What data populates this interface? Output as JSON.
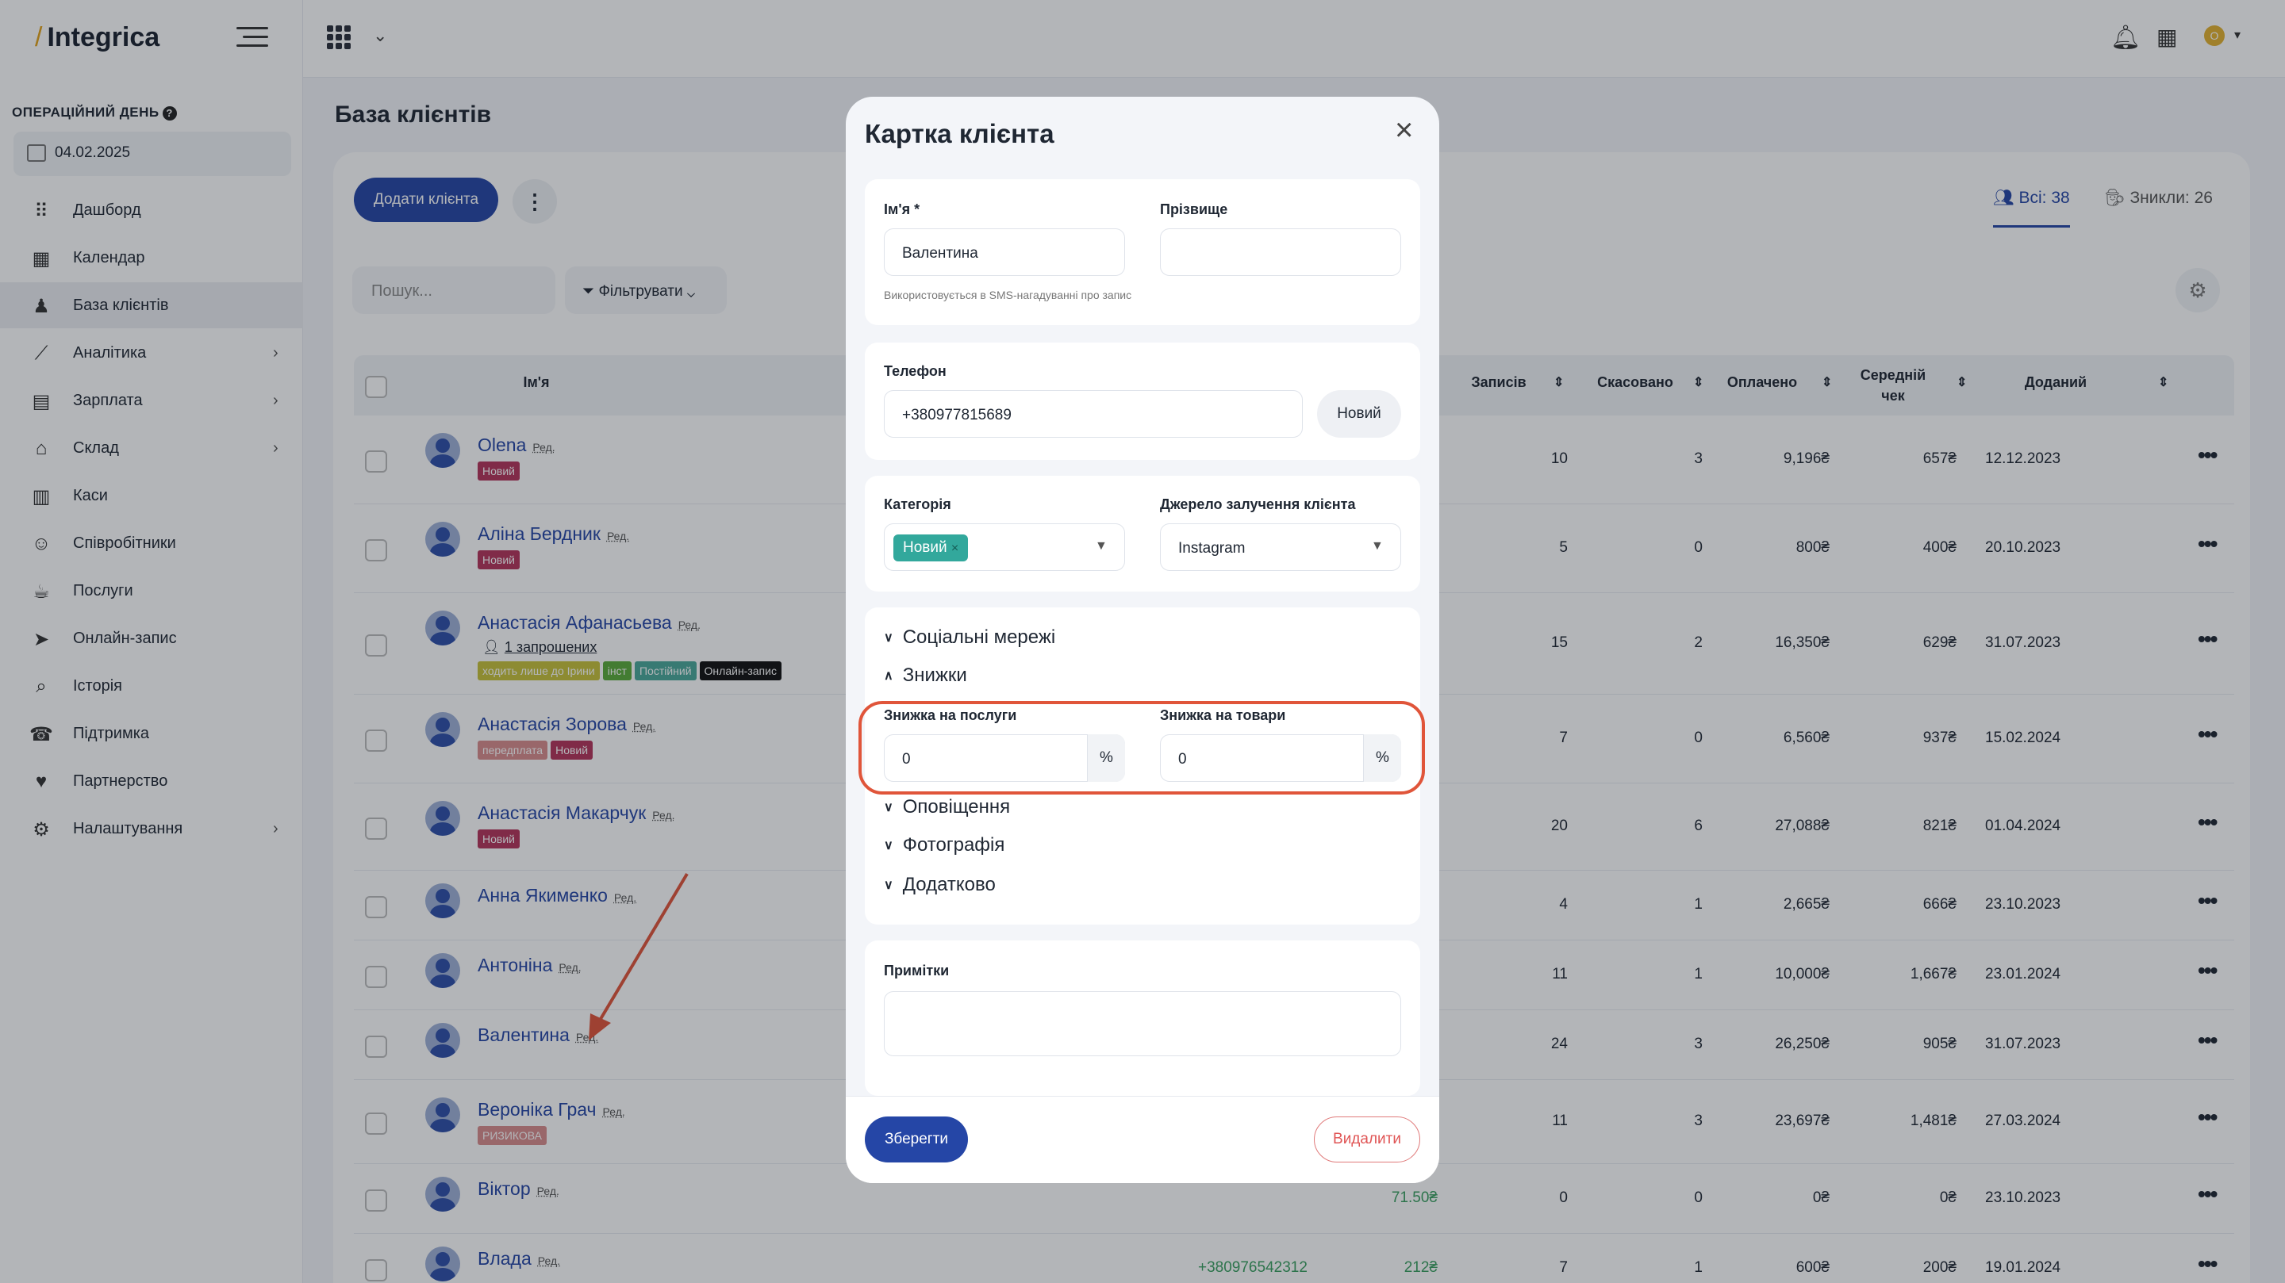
{
  "app": {
    "logo_slash": "/",
    "logo_text": "Integrica"
  },
  "sidebar": {
    "op_day_label": "ОПЕРАЦІЙНИЙ ДЕНЬ",
    "op_day_help": "?",
    "date": "04.02.2025",
    "items": [
      {
        "label": "Дашборд",
        "icon": "dashboard-icon"
      },
      {
        "label": "Календар",
        "icon": "calendar-icon"
      },
      {
        "label": "База клієнтів",
        "icon": "clients-icon"
      },
      {
        "label": "Аналітика",
        "icon": "analytics-icon",
        "chevron": "›"
      },
      {
        "label": "Зарплата",
        "icon": "salary-icon",
        "chevron": "›"
      },
      {
        "label": "Склад",
        "icon": "warehouse-icon",
        "chevron": "›"
      },
      {
        "label": "Каси",
        "icon": "cash-icon"
      },
      {
        "label": "Співробітники",
        "icon": "staff-icon"
      },
      {
        "label": "Послуги",
        "icon": "services-icon"
      },
      {
        "label": "Онлайн-запис",
        "icon": "online-booking-icon"
      },
      {
        "label": "Історія",
        "icon": "history-icon"
      },
      {
        "label": "Підтримка",
        "icon": "support-icon"
      },
      {
        "label": "Партнерство",
        "icon": "heart-icon"
      },
      {
        "label": "Налаштування",
        "icon": "settings-icon",
        "chevron": "›"
      }
    ]
  },
  "topbar": {
    "avatar_letter": "O"
  },
  "page": {
    "title": "База клієнтів",
    "add_button": "Додати клієнта",
    "more": "⋮",
    "tab_all": "Всі: 38",
    "tab_lost": "Зникли: 26",
    "search_placeholder": "Пошук...",
    "filter_label": "Фільтрувати"
  },
  "table": {
    "headers": {
      "name": "Ім'я",
      "visits": "Записів",
      "cancelled": "Скасовано",
      "paid": "Оплачено",
      "avg_check": "Середній чек",
      "added": "Доданий"
    },
    "edit_label": "Ред.",
    "rows": [
      {
        "name": "Olena",
        "tags": [
          {
            "t": "Новий",
            "c": "#b4345a"
          }
        ],
        "visits": "10",
        "cancelled": "3",
        "paid": "9,196₴",
        "avg": "657₴",
        "added": "12.12.2023"
      },
      {
        "name": "Аліна Бердник",
        "tags": [
          {
            "t": "Новий",
            "c": "#b4345a"
          }
        ],
        "visits": "5",
        "cancelled": "0",
        "paid": "800₴",
        "avg": "400₴",
        "added": "20.10.2023"
      },
      {
        "name": "Анастасія Афанасьева",
        "invite": "1 запрошених",
        "tags": [
          {
            "t": "ходить лише до Ірини",
            "c": "#c7c23a"
          },
          {
            "t": "інст",
            "c": "#5bab3a"
          },
          {
            "t": "Постійний",
            "c": "#4aa89a"
          },
          {
            "t": "Онлайн-запис",
            "c": "#111111"
          }
        ],
        "visits": "15",
        "cancelled": "2",
        "paid": "16,350₴",
        "avg": "629₴",
        "added": "31.07.2023"
      },
      {
        "name": "Анастасія Зорова",
        "tags": [
          {
            "t": "передплата",
            "c": "#d98c8c"
          },
          {
            "t": "Новий",
            "c": "#b4345a"
          }
        ],
        "visits": "7",
        "cancelled": "0",
        "paid": "6,560₴",
        "avg": "937₴",
        "added": "15.02.2024"
      },
      {
        "name": "Анастасія Макарчук",
        "tags": [
          {
            "t": "Новий",
            "c": "#b4345a"
          }
        ],
        "visits": "20",
        "cancelled": "6",
        "paid": "27,088₴",
        "avg": "821₴",
        "added": "01.04.2024"
      },
      {
        "name": "Анна Якименко",
        "tags": [],
        "visits": "4",
        "cancelled": "1",
        "paid": "2,665₴",
        "avg": "666₴",
        "added": "23.10.2023"
      },
      {
        "name": "Антоніна",
        "tags": [],
        "visits": "11",
        "cancelled": "1",
        "paid": "10,000₴",
        "avg": "1,667₴",
        "added": "23.01.2024"
      },
      {
        "name": "Валентина",
        "tags": [],
        "visits": "24",
        "cancelled": "3",
        "paid": "26,250₴",
        "avg": "905₴",
        "added": "31.07.2023"
      },
      {
        "name": "Вероніка Грач",
        "tags": [
          {
            "t": "РИЗИКОВА",
            "c": "#d98c8c"
          }
        ],
        "visits": "11",
        "cancelled": "3",
        "paid": "23,697₴",
        "avg": "1,481₴",
        "added": "27.03.2024"
      },
      {
        "name": "Віктор",
        "tags": [],
        "extra": "71.50₴",
        "visits": "0",
        "cancelled": "0",
        "paid": "0₴",
        "avg": "0₴",
        "added": "23.10.2023"
      },
      {
        "name": "Влада",
        "tags": [],
        "phone": "+380976542312",
        "extra": "212₴",
        "visits": "7",
        "cancelled": "1",
        "paid": "600₴",
        "avg": "200₴",
        "added": "19.01.2024"
      }
    ]
  },
  "modal": {
    "title": "Картка клієнта",
    "close": "×",
    "first_name_label": "Ім'я *",
    "first_name_value": "Валентина",
    "last_name_label": "Прізвище",
    "last_name_value": "",
    "sms_hint": "Використовується в SMS-нагадуванні про запис",
    "phone_label": "Телефон",
    "phone_value": "+380977815689",
    "phone_status": "Новий",
    "category_label": "Категорія",
    "category_chip": "Новий",
    "chip_close": "×",
    "source_label": "Джерело залучення клієнта",
    "source_value": "Instagram",
    "acc_social": "Соціальні мережі",
    "acc_discounts": "Знижки",
    "disc_service_label": "Знижка на послуги",
    "disc_service_value": "0",
    "disc_goods_label": "Знижка на товари",
    "disc_goods_value": "0",
    "percent": "%",
    "acc_notifications": "Оповіщення",
    "acc_photo": "Фотографія",
    "acc_extra": "Додатково",
    "notes_label": "Примітки",
    "save": "Зберегти",
    "delete": "Видалити"
  },
  "colors": {
    "accent": "#2546a6",
    "highlight": "#e0553a"
  }
}
